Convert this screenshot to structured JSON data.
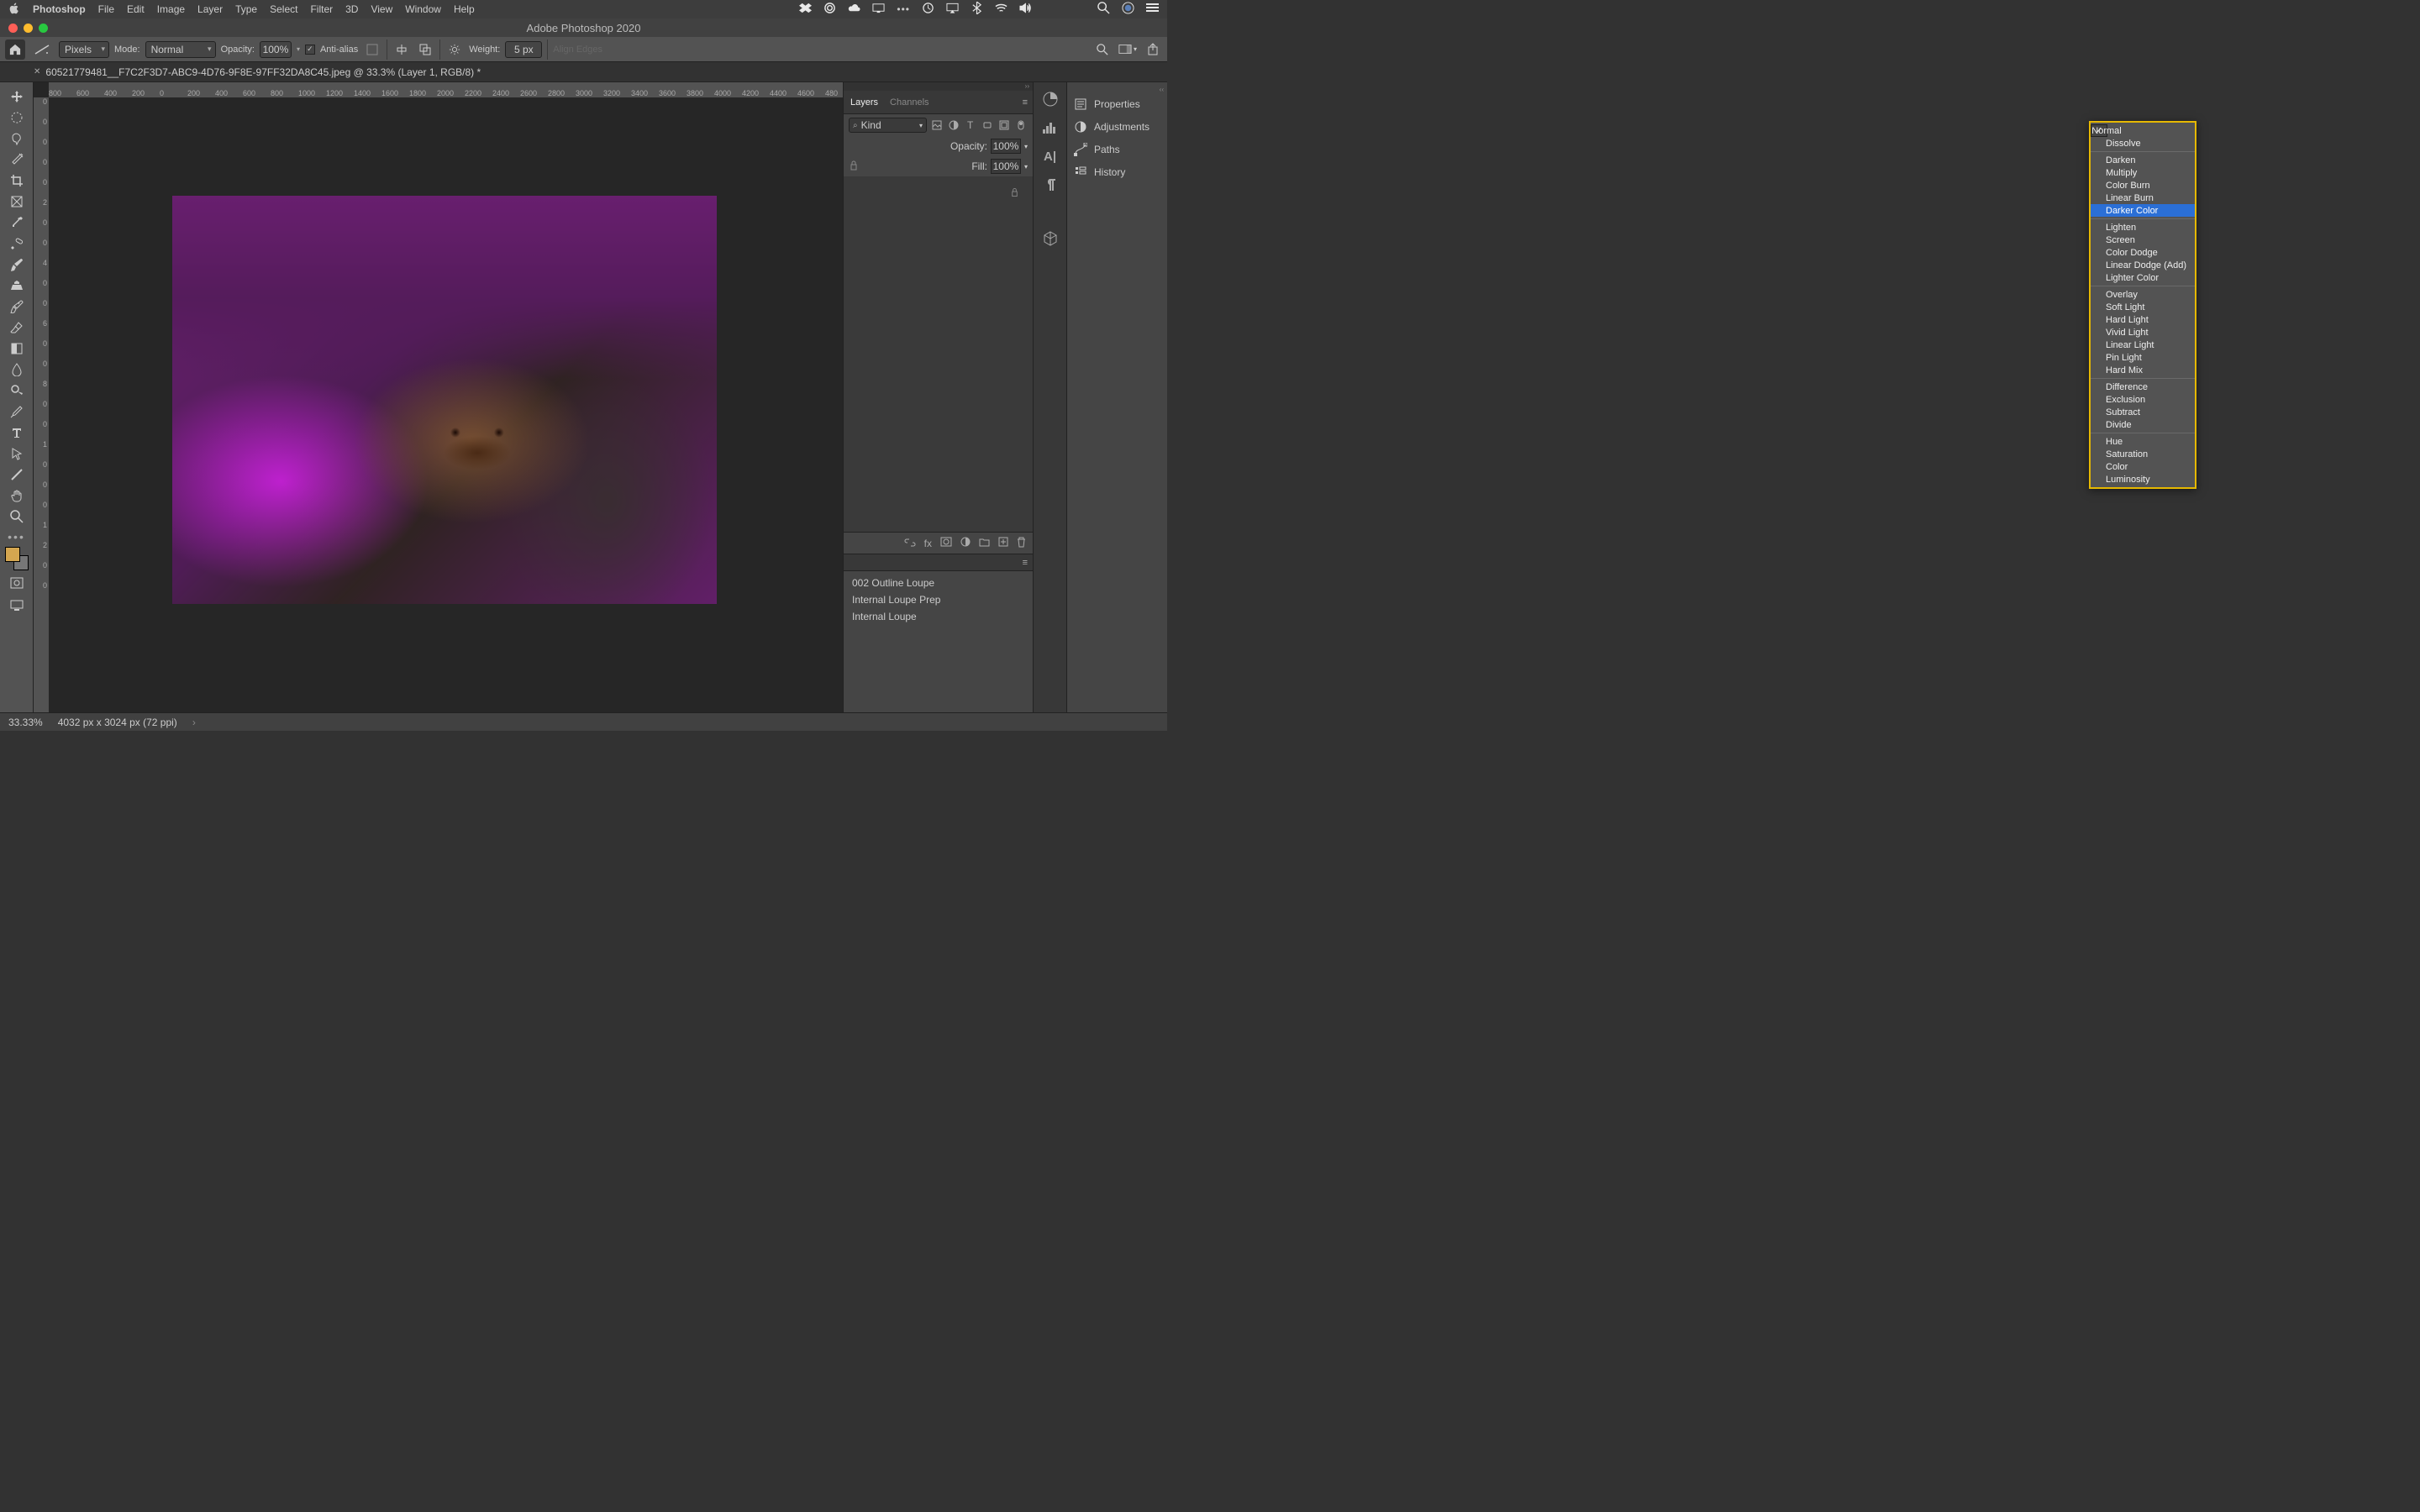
{
  "menubar": {
    "apple": "",
    "app": "Photoshop",
    "items": [
      "File",
      "Edit",
      "Image",
      "Layer",
      "Type",
      "Select",
      "Filter",
      "3D",
      "View",
      "Window",
      "Help"
    ]
  },
  "titlebar": {
    "title": "Adobe Photoshop 2020"
  },
  "optionsbar": {
    "units": "Pixels",
    "mode_label": "Mode:",
    "mode_value": "Normal",
    "opacity_label": "Opacity:",
    "opacity_value": "100%",
    "antialias_label": "Anti-alias",
    "weight_label": "Weight:",
    "weight_value": "5 px",
    "align_label": "Align Edges"
  },
  "document_tab": {
    "label": "60521779481__F7C2F3D7-ABC9-4D76-9F8E-97FF32DA8C45.jpeg @ 33.3% (Layer 1, RGB/8) *"
  },
  "ruler_h": [
    "800",
    "600",
    "400",
    "200",
    "0",
    "200",
    "400",
    "600",
    "800",
    "1000",
    "1200",
    "1400",
    "1600",
    "1800",
    "2000",
    "2200",
    "2400",
    "2600",
    "2800",
    "3000",
    "3200",
    "3400",
    "3600",
    "3800",
    "4000",
    "4200",
    "4400",
    "4600",
    "480"
  ],
  "ruler_v": [
    "0",
    "0",
    "0",
    "0",
    "0",
    "2",
    "0",
    "0",
    "4",
    "0",
    "0",
    "6",
    "0",
    "0",
    "8",
    "0",
    "0",
    "1",
    "0",
    "0",
    "0",
    "1",
    "2",
    "0",
    "0"
  ],
  "layers_panel": {
    "tabs": [
      "Layers",
      "Channels"
    ],
    "active_tab": "Layers",
    "kind": "Kind",
    "opacity_label": "Opacity:",
    "opacity_value": "100%",
    "fill_label": "Fill:",
    "fill_value": "100%"
  },
  "blend_modes": {
    "checked": "Normal",
    "selected": "Darker Color",
    "groups": [
      [
        "Normal",
        "Dissolve"
      ],
      [
        "Darken",
        "Multiply",
        "Color Burn",
        "Linear Burn",
        "Darker Color"
      ],
      [
        "Lighten",
        "Screen",
        "Color Dodge",
        "Linear Dodge (Add)",
        "Lighter Color"
      ],
      [
        "Overlay",
        "Soft Light",
        "Hard Light",
        "Vivid Light",
        "Linear Light",
        "Pin Light",
        "Hard Mix"
      ],
      [
        "Difference",
        "Exclusion",
        "Subtract",
        "Divide"
      ],
      [
        "Hue",
        "Saturation",
        "Color",
        "Luminosity"
      ]
    ]
  },
  "bottom_panel": {
    "rows": [
      "002 Outline Loupe",
      "Internal Loupe Prep",
      "Internal Loupe"
    ]
  },
  "right_props": [
    "Properties",
    "Adjustments",
    "Paths",
    "History"
  ],
  "statusbar": {
    "zoom": "33.33%",
    "doc": "4032 px x 3024 px (72 ppi)"
  },
  "colors": {
    "highlight": "#e6b800",
    "blend_sel": "#2b6fd6",
    "swatch_fg": "#d4a650"
  }
}
